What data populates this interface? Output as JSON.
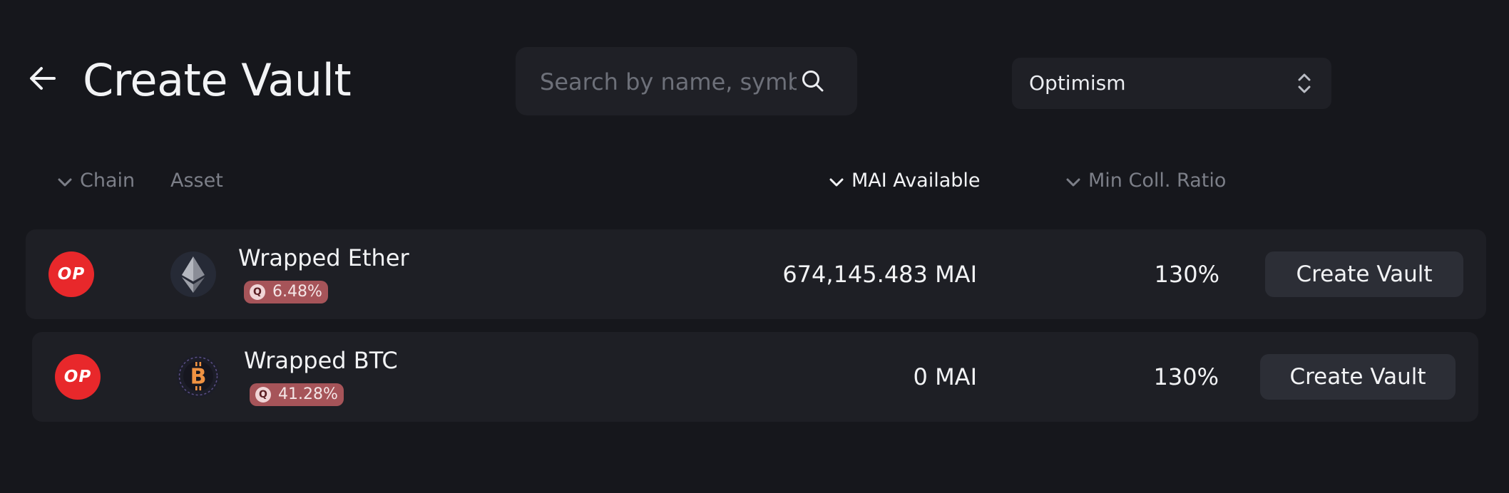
{
  "header": {
    "title": "Create Vault",
    "search_placeholder": "Search by name, symbol",
    "chain_selected": "Optimism"
  },
  "columns": {
    "chain": "Chain",
    "asset": "Asset",
    "mai_available": "MAI Available",
    "min_coll_ratio": "Min Coll. Ratio"
  },
  "rows": [
    {
      "chain_logo_text": "OP",
      "asset_icon": "ethereum-icon",
      "asset_name": "Wrapped Ether",
      "apr": "6.48%",
      "mai_available": "674,145.483 MAI",
      "min_coll_ratio": "130%",
      "action": "Create Vault"
    },
    {
      "chain_logo_text": "OP",
      "asset_icon": "bitcoin-icon",
      "asset_name": "Wrapped BTC",
      "apr": "41.28%",
      "mai_available": "0 MAI",
      "min_coll_ratio": "130%",
      "action": "Create Vault"
    }
  ],
  "colors": {
    "background": "#16171c",
    "surface": "#1e1f25",
    "op_red": "#e8282b",
    "apr_badge": "#a65459"
  }
}
